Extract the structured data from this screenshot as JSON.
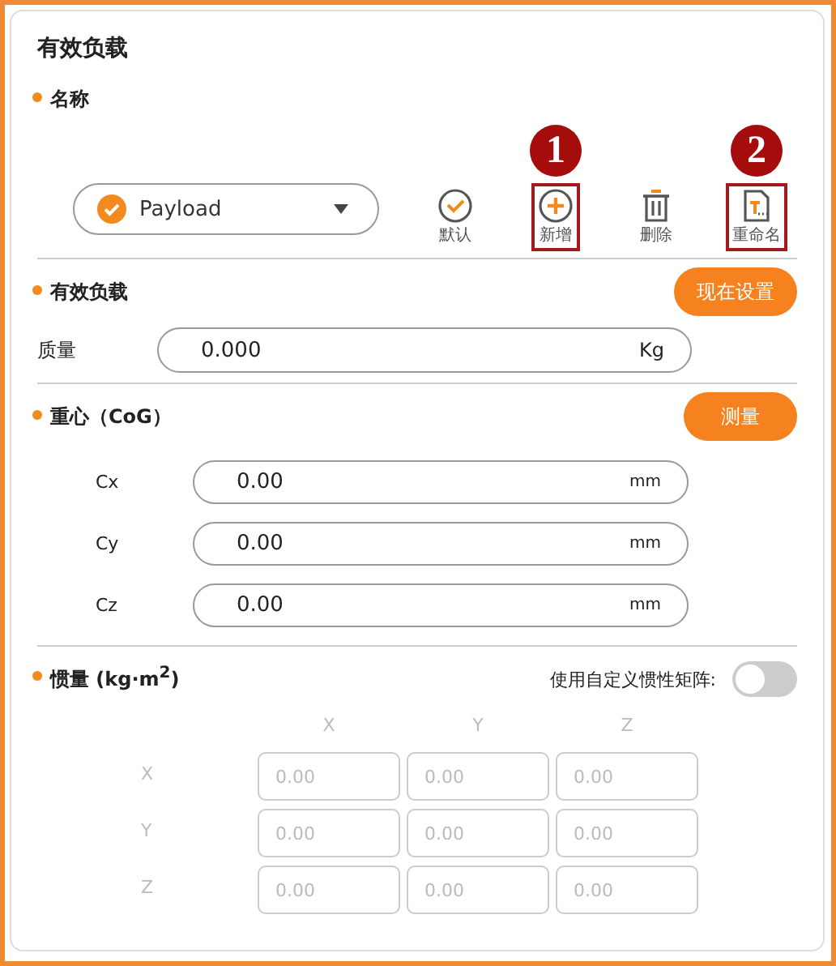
{
  "title": "有效负载",
  "name_section": {
    "label": "名称",
    "dropdown": {
      "value": "Payload",
      "checked": true
    },
    "actions": [
      {
        "kind": "check",
        "label": "默认"
      },
      {
        "kind": "add",
        "label": "新增",
        "callout": "1"
      },
      {
        "kind": "delete",
        "label": "删除"
      },
      {
        "kind": "rename",
        "label": "重命名",
        "callout": "2"
      }
    ]
  },
  "payload_section": {
    "label": "有效负载",
    "button": "现在设置",
    "mass": {
      "label": "质量",
      "value": "0.000",
      "unit": "Kg"
    }
  },
  "cog_section": {
    "label": "重心（CoG）",
    "button": "测量",
    "fields": [
      {
        "label": "Cx",
        "value": "0.00",
        "unit": "mm"
      },
      {
        "label": "Cy",
        "value": "0.00",
        "unit": "mm"
      },
      {
        "label": "Cz",
        "value": "0.00",
        "unit": "mm"
      }
    ]
  },
  "inertia_section": {
    "label": "惯量 (kg·m$^{2}$)",
    "toggle_label": "使用自定义惯性矩阵:",
    "custom_matrix": {
      "on": false
    },
    "columns": [
      "X",
      "Y",
      "Z"
    ],
    "rows": [
      {
        "label": "X",
        "values": [
          "0.00",
          "0.00",
          "0.00"
        ]
      },
      {
        "label": "Y",
        "values": [
          "0.00",
          "0.00",
          "0.00"
        ]
      },
      {
        "label": "Z",
        "values": [
          "0.00",
          "0.00",
          "0.00"
        ]
      }
    ]
  }
}
